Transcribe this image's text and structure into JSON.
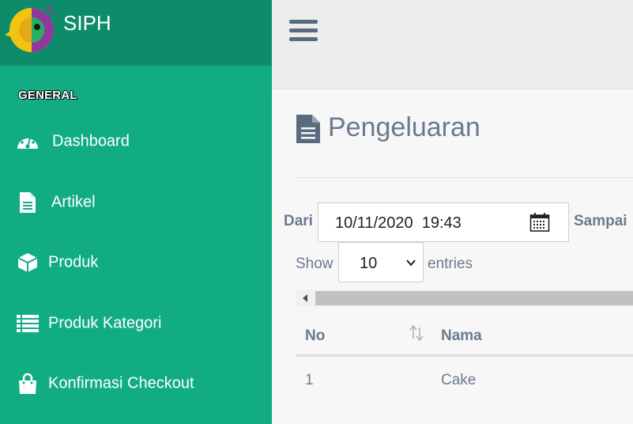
{
  "brand": {
    "name": "SIPH"
  },
  "sidebar": {
    "section_title": "GENERAL",
    "items": [
      {
        "label": "Dashboard",
        "icon": "dashboard-icon"
      },
      {
        "label": "Artikel",
        "icon": "file-icon"
      },
      {
        "label": "Produk",
        "icon": "cube-icon"
      },
      {
        "label": "Produk Kategori",
        "icon": "list-icon"
      },
      {
        "label": "Konfirmasi Checkout",
        "icon": "shopping-bag-icon"
      }
    ]
  },
  "page": {
    "title": "Pengeluaran",
    "title_icon": "file-icon"
  },
  "filter": {
    "from_label": "Dari",
    "from_value": "10/11/2020  19:43",
    "to_label": "Sampai"
  },
  "table_controls": {
    "show_label": "Show",
    "page_size": "10",
    "entries_label": "entries"
  },
  "table": {
    "columns": [
      "No",
      "Nama"
    ],
    "rows": [
      {
        "no": "1",
        "nama": "Cake"
      }
    ]
  },
  "colors": {
    "sidebar": "#12ac83",
    "brand_bar": "#0e8c6a",
    "text_muted": "#6c7a8f",
    "topbar": "#ededed"
  }
}
